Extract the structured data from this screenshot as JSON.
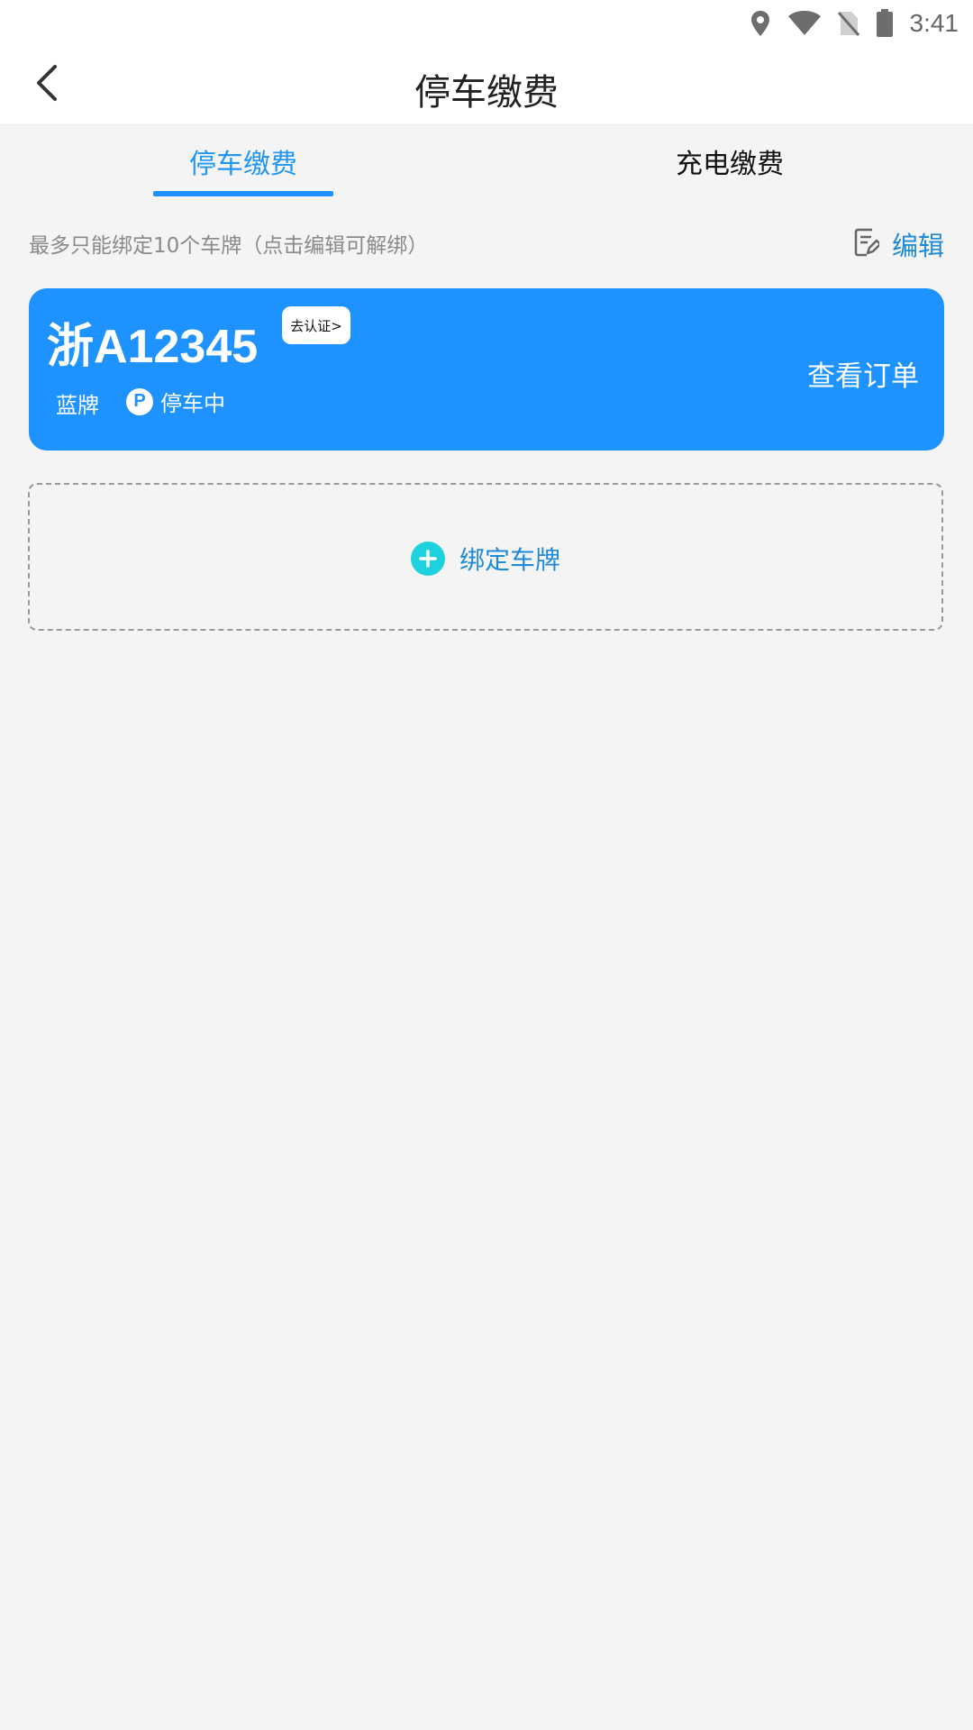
{
  "status_bar": {
    "time": "3:41",
    "icons": [
      "location-icon",
      "wifi-icon",
      "no-sim-icon",
      "battery-icon"
    ]
  },
  "app_bar": {
    "back_icon": "chevron-left-icon",
    "title": "停车缴费"
  },
  "tabs": [
    {
      "label": "停车缴费",
      "active": true
    },
    {
      "label": "充电缴费",
      "active": false
    }
  ],
  "hint": {
    "text": "最多只能绑定10个车牌（点击编辑可解绑）",
    "edit_label": "编辑",
    "edit_icon": "edit-note-icon"
  },
  "plate_card": {
    "plate_number": "浙A12345",
    "verify_badge": "去认证>",
    "plate_type": "蓝牌",
    "parking_icon_letter": "P",
    "parking_status": "停车中",
    "view_orders": "查看订单",
    "color": "#1e93ff"
  },
  "bind": {
    "label": "绑定车牌",
    "icon": "plus-circle-icon"
  },
  "colors": {
    "accent": "#1e90ff",
    "link": "#1f8ad8",
    "plus": "#1ed1de",
    "background": "#f4f4f4"
  }
}
